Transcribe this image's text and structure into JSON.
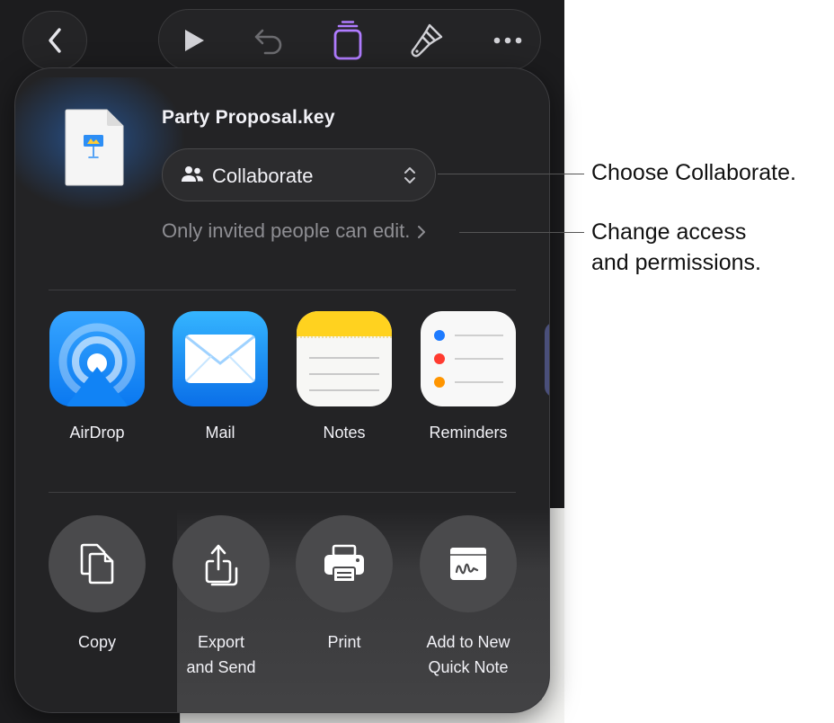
{
  "document": {
    "title": "Party Proposal.key"
  },
  "share_mode": {
    "selected": "Collaborate"
  },
  "access_summary": "Only invited people can edit.",
  "apps": [
    {
      "label": "AirDrop",
      "icon": "airdrop-icon"
    },
    {
      "label": "Mail",
      "icon": "mail-icon"
    },
    {
      "label": "Notes",
      "icon": "notes-icon"
    },
    {
      "label": "Reminders",
      "icon": "reminders-icon"
    }
  ],
  "actions": [
    {
      "line1": "Copy",
      "line2": "",
      "icon": "copy-icon"
    },
    {
      "line1": "Export",
      "line2": "and Send",
      "icon": "export-icon"
    },
    {
      "line1": "Print",
      "line2": "",
      "icon": "print-icon"
    },
    {
      "line1": "Add to New",
      "line2": "Quick Note",
      "icon": "quick-note-icon"
    }
  ],
  "callouts": {
    "collaborate": "Choose Collaborate.",
    "access_line1": "Change access",
    "access_line2": "and permissions."
  },
  "toolbar": {
    "icons": [
      "back-icon",
      "play-icon",
      "undo-icon",
      "document-stack-icon",
      "paintbrush-icon",
      "more-icon"
    ]
  },
  "colors": {
    "accent_purple": "#b07cff",
    "panel_bg": "#232325",
    "airdrop_blue": "#1a8cff",
    "notes_yellow": "#ffd21f"
  }
}
